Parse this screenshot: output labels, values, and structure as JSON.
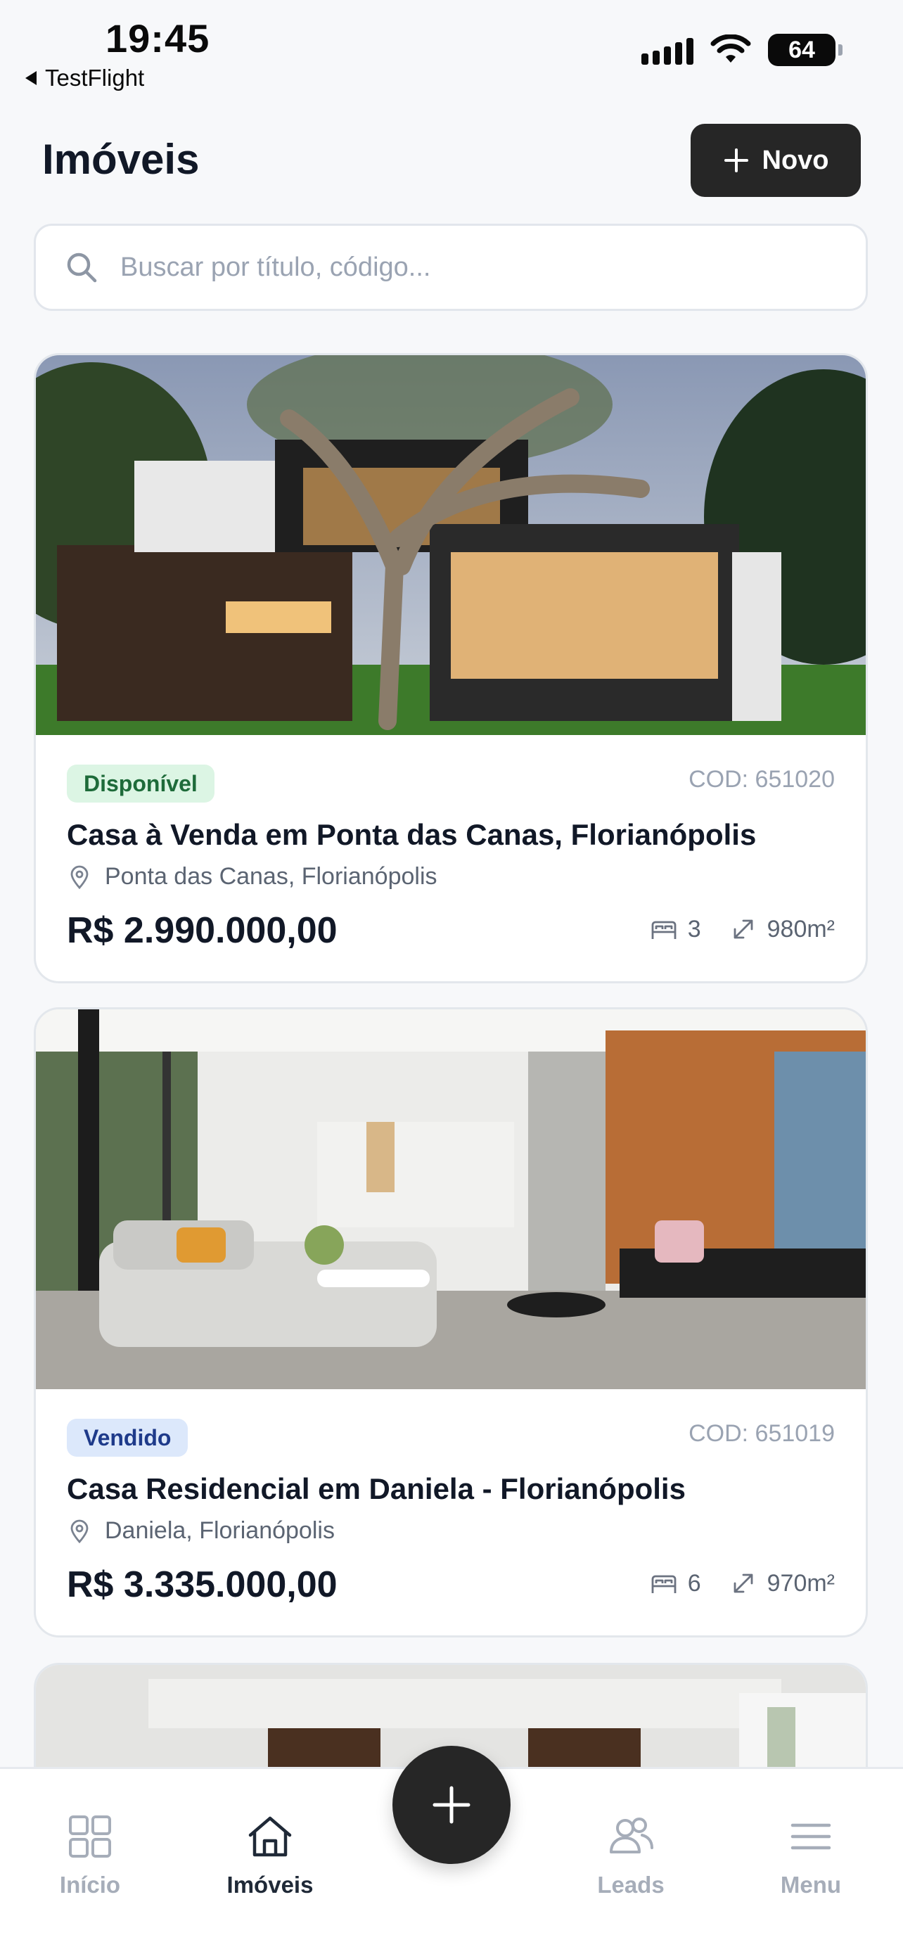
{
  "status_bar": {
    "time": "19:45",
    "back_app": "TestFlight",
    "battery": "64"
  },
  "header": {
    "title": "Imóveis",
    "new_button": "Novo"
  },
  "search": {
    "placeholder": "Buscar por título, código..."
  },
  "properties": [
    {
      "status": "Disponível",
      "code": "COD: 651020",
      "title": "Casa à Venda em Ponta das Canas, Florianópolis",
      "location": "Ponta das Canas, Florianópolis",
      "price": "R$ 2.990.000,00",
      "bedrooms": "3",
      "area": "980m²"
    },
    {
      "status": "Vendido",
      "code": "COD: 651019",
      "title": "Casa Residencial em Daniela - Florianópolis",
      "location": "Daniela, Florianópolis",
      "price": "R$ 3.335.000,00",
      "bedrooms": "6",
      "area": "970m²"
    }
  ],
  "bottom_nav": {
    "items": [
      {
        "label": "Início",
        "icon": "grid-icon"
      },
      {
        "label": "Imóveis",
        "icon": "home-icon"
      },
      {
        "label": "Leads",
        "icon": "users-icon"
      },
      {
        "label": "Menu",
        "icon": "menu-icon"
      }
    ],
    "active": "Imóveis",
    "fab_icon": "plus-icon"
  }
}
